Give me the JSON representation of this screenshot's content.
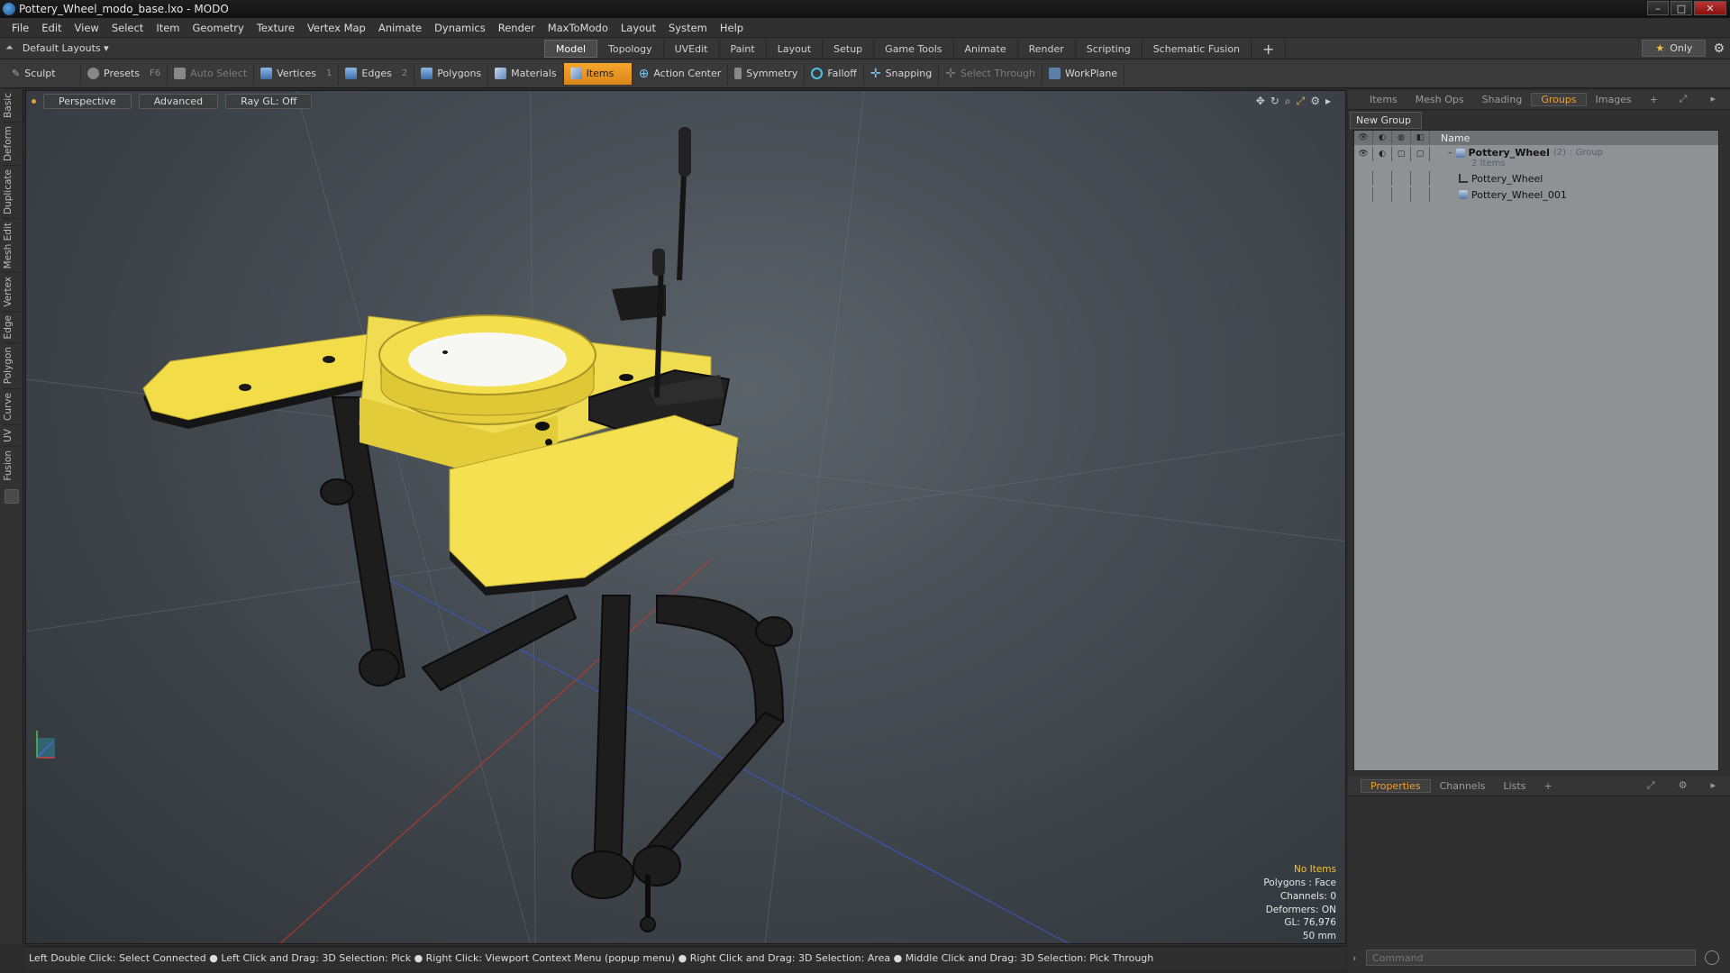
{
  "window": {
    "title": "Pottery_Wheel_modo_base.lxo - MODO",
    "min": "–",
    "max": "□",
    "close": "✕"
  },
  "menu": [
    "File",
    "Edit",
    "View",
    "Select",
    "Item",
    "Geometry",
    "Texture",
    "Vertex Map",
    "Animate",
    "Dynamics",
    "Render",
    "MaxToModo",
    "Layout",
    "System",
    "Help"
  ],
  "layoutbar": {
    "layout_name": "Default Layouts",
    "tabs": [
      "Model",
      "Topology",
      "UVEdit",
      "Paint",
      "Layout",
      "Setup",
      "Game Tools",
      "Animate",
      "Render",
      "Scripting",
      "Schematic Fusion"
    ],
    "active_tab": "Model",
    "add_tab": "+",
    "only_label": "Only"
  },
  "toolbar": {
    "sculpt": "Sculpt",
    "presets": "Presets",
    "presets_key": "F6",
    "auto_select": "Auto Select",
    "vertices": "Vertices",
    "vertices_key": "1",
    "edges": "Edges",
    "edges_key": "2",
    "polygons": "Polygons",
    "materials": "Materials",
    "items": "Items",
    "action_center": "Action Center",
    "symmetry": "Symmetry",
    "falloff": "Falloff",
    "snapping": "Snapping",
    "select_through": "Select Through",
    "workplane": "WorkPlane"
  },
  "left_tabs": [
    "Basic",
    "Deform",
    "Duplicate",
    "Mesh Edit",
    "Vertex",
    "Edge",
    "Polygon",
    "Curve",
    "UV",
    "Fusion"
  ],
  "viewport": {
    "view": "Perspective",
    "shading": "Advanced",
    "raygl": "Ray GL: Off",
    "hud": {
      "items": "No Items",
      "polygons": "Polygons : Face",
      "channels": "Channels: 0",
      "deformers": "Deformers: ON",
      "gl": "GL: 76,976",
      "units": "50 mm"
    },
    "colors": {
      "model_yellow": "#f5e04a",
      "model_dark": "#1e1e1e",
      "bg": "#4b5258"
    }
  },
  "status": "Left Double Click: Select Connected ● Left Click and Drag: 3D Selection: Pick ● Right Click: Viewport Context Menu (popup menu) ● Right Click and Drag: 3D Selection: Area ● Middle Click and Drag: 3D Selection: Pick Through",
  "right_panel": {
    "tabs": [
      "Items",
      "Mesh Ops",
      "Shading",
      "Groups",
      "Images"
    ],
    "active_tab": "Groups",
    "add_tab": "+",
    "new_group": "New Group",
    "tree_header": "Name",
    "group": {
      "name": "Pottery_Wheel",
      "count": "(2)",
      "type": ": Group",
      "sub": "2 Items"
    },
    "children": [
      "Pottery_Wheel",
      "Pottery_Wheel_001"
    ],
    "bottom_tabs": [
      "Properties",
      "Channels",
      "Lists"
    ],
    "bottom_active": "Properties",
    "command_placeholder": "Command"
  }
}
